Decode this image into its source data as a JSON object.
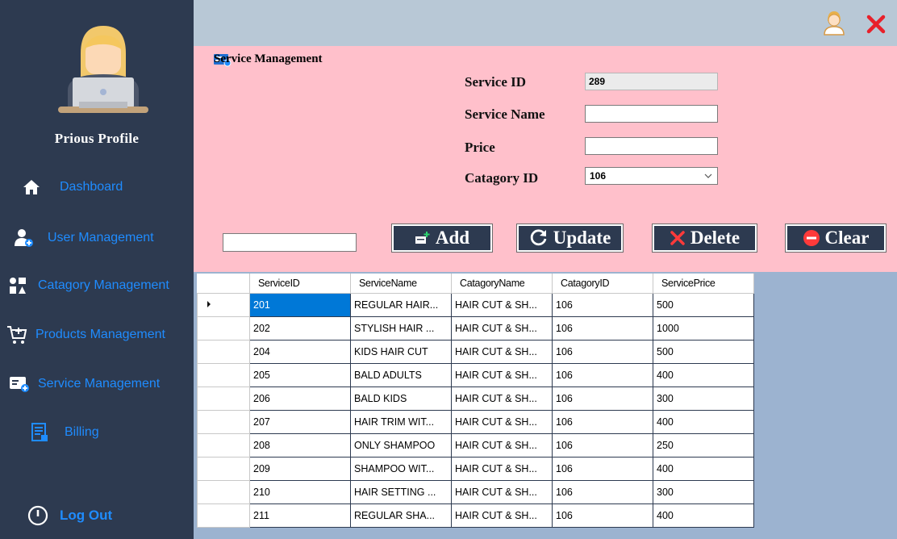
{
  "profile": {
    "name": "Prious  Profile"
  },
  "sidebar": {
    "items": [
      {
        "label": "Dashboard",
        "icon": "home-icon"
      },
      {
        "label": "User Management",
        "icon": "add-user-icon"
      },
      {
        "label": "Catagory Management",
        "icon": "category-icon"
      },
      {
        "label": "Products Management",
        "icon": "cart-add-icon"
      },
      {
        "label": "Service Management",
        "icon": "service-card-icon"
      },
      {
        "label": "Billing",
        "icon": "bill-icon"
      }
    ],
    "logout_label": "Log Out"
  },
  "section": {
    "title": "Service Management"
  },
  "form": {
    "service_id_label": "Service ID",
    "service_id_value": "289",
    "service_name_label": "Service Name",
    "service_name_value": "",
    "price_label": "Price",
    "price_value": "",
    "category_id_label": "Catagory ID",
    "category_id_value": "106"
  },
  "buttons": {
    "add": "Add",
    "update": "Update",
    "delete": "Delete",
    "clear": "Clear"
  },
  "table": {
    "columns": [
      "ServiceID",
      "ServiceName",
      "CatagoryName",
      "CatagoryID",
      "ServicePrice"
    ],
    "rows": [
      [
        "201",
        "REGULAR HAIR...",
        "HAIR CUT & SH...",
        "106",
        "500"
      ],
      [
        "202",
        "STYLISH HAIR ...",
        "HAIR CUT & SH...",
        "106",
        "1000"
      ],
      [
        "204",
        "KIDS HAIR CUT",
        "HAIR CUT & SH...",
        "106",
        "500"
      ],
      [
        "205",
        "BALD ADULTS",
        "HAIR CUT & SH...",
        "106",
        "400"
      ],
      [
        "206",
        "BALD KIDS",
        "HAIR CUT & SH...",
        "106",
        "300"
      ],
      [
        "207",
        "HAIR TRIM WIT...",
        "HAIR CUT & SH...",
        "106",
        "400"
      ],
      [
        "208",
        "ONLY SHAMPOO",
        "HAIR CUT & SH...",
        "106",
        "250"
      ],
      [
        "209",
        "SHAMPOO WIT...",
        "HAIR CUT & SH...",
        "106",
        "400"
      ],
      [
        "210",
        "HAIR SETTING ...",
        "HAIR CUT & SH...",
        "106",
        "300"
      ],
      [
        "211",
        "REGULAR SHA...",
        "HAIR CUT & SH...",
        "106",
        "400"
      ]
    ]
  },
  "colors": {
    "sidebar": "#2d3a50",
    "accent": "#1f8cff",
    "form_bg": "#ffc0cb",
    "topbar": "#b8c8d6",
    "grid_bg": "#9cb3d0",
    "close": "#e8202a"
  }
}
